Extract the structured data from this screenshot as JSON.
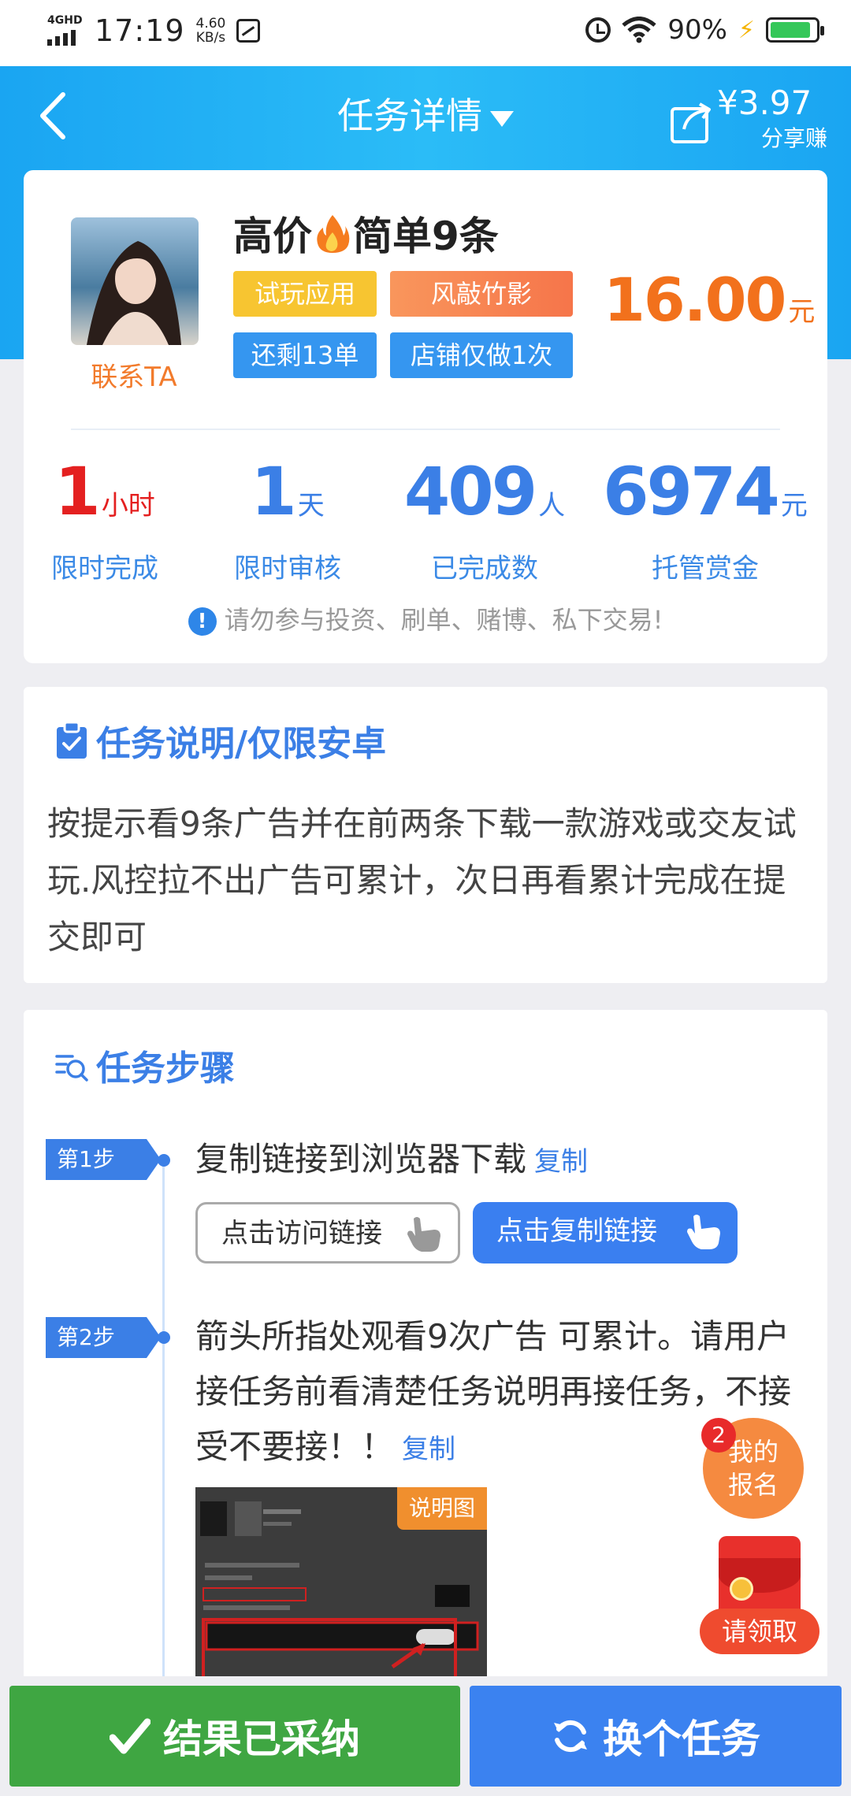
{
  "status_bar": {
    "network": "4GHD",
    "time": "17:19",
    "speed_value": "4.60",
    "speed_unit": "KB/s",
    "battery": "90%"
  },
  "nav": {
    "title": "任务详情",
    "share_amount": "¥3.97",
    "share_label": "分享赚"
  },
  "task": {
    "title_part1": "高价",
    "title_part2": "简单9条",
    "tags": [
      "试玩应用",
      "风敲竹影",
      "还剩13单",
      "店铺仅做1次"
    ],
    "price": "16.00",
    "price_unit": "元",
    "contact": "联系TA"
  },
  "stats": [
    {
      "value": "1",
      "unit": "小时",
      "caption": "限时完成"
    },
    {
      "value": "1",
      "unit": "天",
      "caption": "限时审核"
    },
    {
      "value": "409",
      "unit": "人",
      "caption": "已完成数"
    },
    {
      "value": "6974",
      "unit": "元",
      "caption": "托管赏金"
    }
  ],
  "warning": "请勿参与投资、刷单、赌博、私下交易!",
  "description": {
    "title": "任务说明/仅限安卓",
    "text": "按提示看9条广告并在前两条下载一款游戏或交友试玩.风控拉不出广告可累计，次日再看累计完成在提交即可"
  },
  "steps": {
    "title": "任务步骤",
    "items": [
      {
        "badge": "第1步",
        "text": "复制链接到浏览器下载",
        "copy": "复制"
      },
      {
        "badge": "第2步",
        "text": "箭头所指处观看9次广告 可累计。请用户接任务前看清楚任务说明再接任务，不接受不要接！！",
        "copy": "复制"
      }
    ],
    "visit_link": "点击访问链接",
    "copy_link": "点击复制链接",
    "image_tag": "说明图"
  },
  "floating": {
    "my_signup_line1": "我的",
    "my_signup_line2": "报名",
    "badge_count": "2",
    "claim": "请领取"
  },
  "bottom": {
    "accept": "结果已采纳",
    "switch": "换个任务"
  },
  "colors": {
    "header": "#1aa5f2",
    "accent_blue": "#3b7fe6",
    "price_orange": "#f2711c",
    "green": "#3fa642"
  }
}
